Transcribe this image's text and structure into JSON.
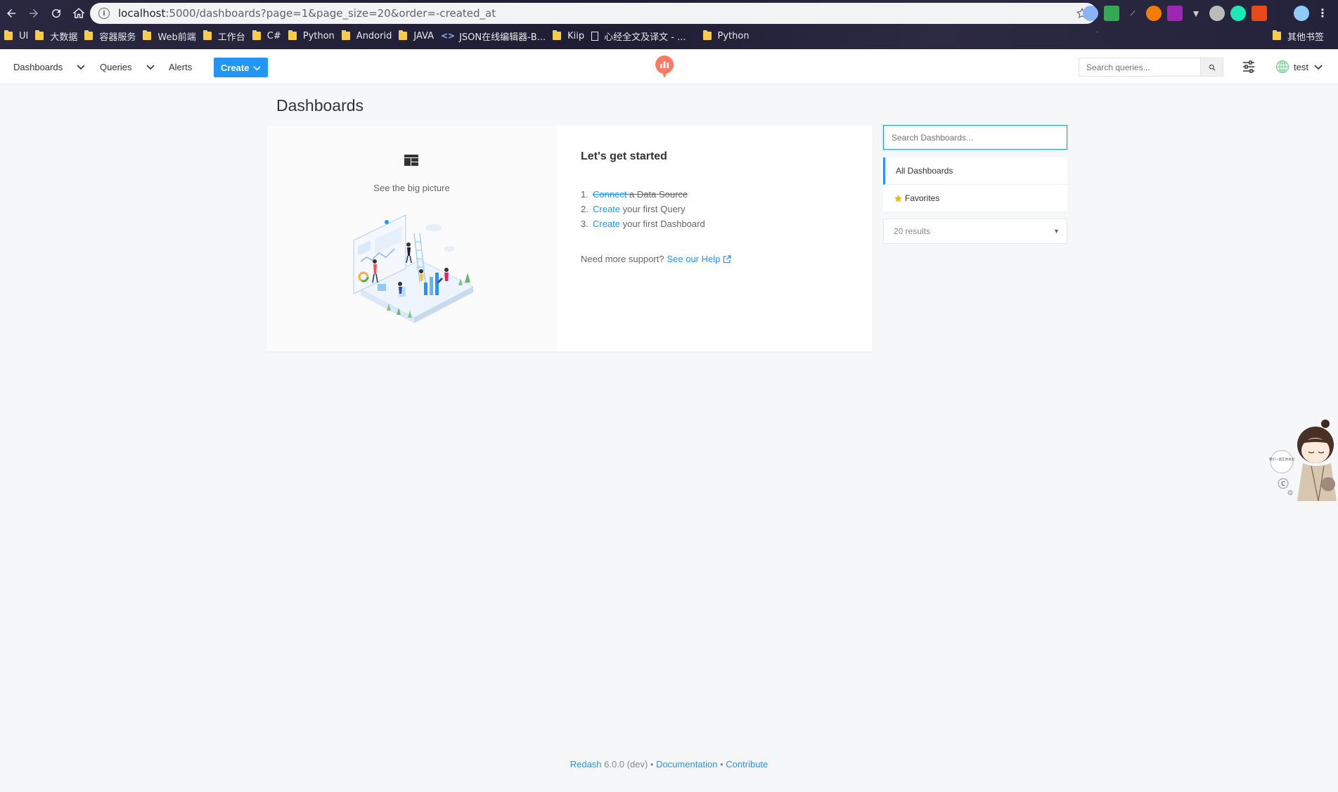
{
  "browser": {
    "url_host": "localhost",
    "url_rest": ":5000/dashboards?page=1&page_size=20&order=-created_at",
    "bookmarks": [
      "UI",
      "大数据",
      "容器服务",
      "Web前端",
      "工作台",
      "C#",
      "Python",
      "Andorid",
      "JAVA",
      "JSON在线编辑器-B...",
      "Kiip",
      "心经全文及译文 - ...",
      "Python"
    ],
    "other_bookmarks": "其他书签"
  },
  "header": {
    "dashboards": "Dashboards",
    "queries": "Queries",
    "alerts": "Alerts",
    "create": "Create",
    "search_placeholder": "Search queries...",
    "user": "test",
    "brand_color": "#2196f3",
    "logo_color": "#ff7964"
  },
  "page": {
    "title": "Dashboards"
  },
  "empty_state": {
    "caption": "See the big picture",
    "heading": "Let's get started",
    "steps": [
      {
        "num": "1.",
        "link": "Connect",
        "text": " a Data Source"
      },
      {
        "num": "2.",
        "link": "Create",
        "text": " your first Query"
      },
      {
        "num": "3.",
        "link": "Create",
        "text": " your first Dashboard"
      }
    ],
    "support_text": "Need more support?",
    "support_link": "See our Help"
  },
  "sidebar": {
    "search_placeholder": "Search Dashboards...",
    "items": [
      "All Dashboards",
      "Favorites"
    ],
    "results": "20 results"
  },
  "footer": {
    "product": "Redash",
    "version": " 6.0.0 (dev) • ",
    "docs": "Documentation",
    "sep": " • ",
    "contribute": "Contribute"
  },
  "mascot": {
    "bubble_text": "我们一直在你身边"
  }
}
